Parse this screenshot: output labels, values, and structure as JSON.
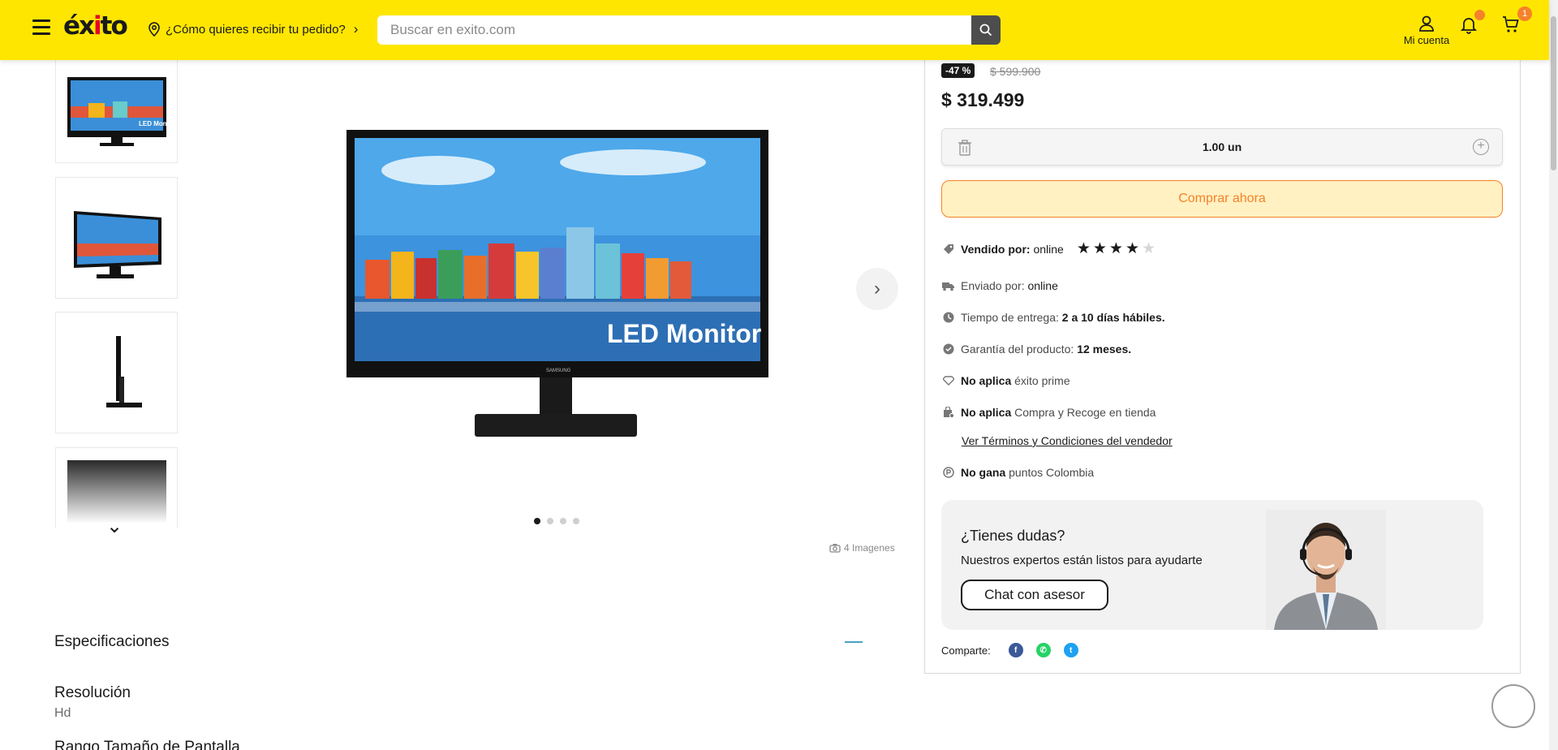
{
  "header": {
    "logo_text": "éxito",
    "location_label": "¿Cómo quieres recibir tu pedido?",
    "search_placeholder": "Buscar en exito.com",
    "account_label": "Mi cuenta",
    "cart_count": "1",
    "brand_color": "#ffe600",
    "accent_color": "#f5822a"
  },
  "gallery": {
    "thumbnails": [
      {
        "name": "monitor-front-thumb"
      },
      {
        "name": "monitor-angle-thumb"
      },
      {
        "name": "monitor-side-thumb"
      },
      {
        "name": "monitor-back-thumb"
      }
    ],
    "main_image_text": "LED Monitor",
    "brand_text": "SAMSUNG",
    "active_dot": 1,
    "dot_count": 4,
    "image_count_label": "4 Imagenes"
  },
  "specs": {
    "title": "Especificaciones",
    "items": [
      {
        "label": "Resolución",
        "value": "Hd"
      },
      {
        "label": "Rango Tamaño de Pantalla",
        "value": ""
      }
    ]
  },
  "product": {
    "discount": "-47 %",
    "old_price": "$ 599.900",
    "price": "$ 319.499",
    "quantity": "1.00 un",
    "buy_label": "Comprar ahora",
    "rating": 4,
    "rating_max": 5
  },
  "info": {
    "sold_by_label": "Vendido por:",
    "sold_by_value": "online",
    "shipped_by_label": "Enviado por:",
    "shipped_by_value": "online",
    "delivery_label": "Tiempo de entrega:",
    "delivery_value": "2 a 10 días hábiles.",
    "warranty_label": "Garantía del producto:",
    "warranty_value": "12 meses.",
    "prime_strong": "No aplica",
    "prime_text": "éxito prime",
    "pickup_strong": "No aplica",
    "pickup_text": "Compra y Recoge en tienda",
    "terms_link": "Ver Términos y Condiciones del vendedor",
    "points_strong": "No gana",
    "points_text": "puntos Colombia"
  },
  "help": {
    "title": "¿Tienes dudas?",
    "subtitle": "Nuestros expertos están listos para ayudarte",
    "chat_button": "Chat con asesor"
  },
  "share": {
    "label": "Comparte:"
  }
}
